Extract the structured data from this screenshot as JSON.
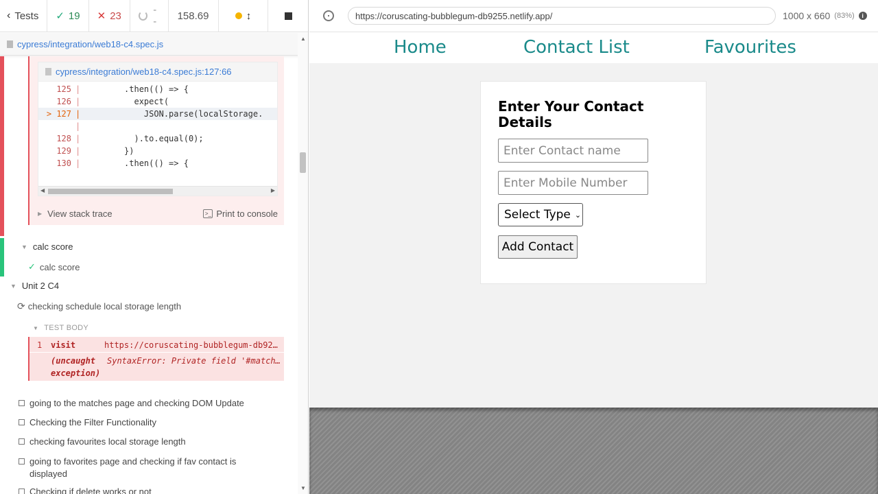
{
  "stats": {
    "tests_label": "Tests",
    "passed": "19",
    "failed": "23",
    "pending": "--",
    "duration": "158.69"
  },
  "spec": {
    "path": "cypress/integration/web18-c4.spec.js"
  },
  "error": {
    "code_frame_path": "cypress/integration/web18-c4.spec.js:127:66",
    "lines": [
      {
        "num": "125",
        "code": "        .then(() => {"
      },
      {
        "num": "126",
        "code": "          expect("
      },
      {
        "num": "127",
        "code": "            JSON.parse(localStorage."
      },
      {
        "num": "",
        "code": ""
      },
      {
        "num": "128",
        "code": "          ).to.equal(0);"
      },
      {
        "num": "129",
        "code": "        })"
      },
      {
        "num": "130",
        "code": "        .then(() => {"
      }
    ],
    "highlight_marker": ">",
    "view_stack_trace": "View stack trace",
    "print_to_console": "Print to console"
  },
  "tree": {
    "calc_suite": "calc score",
    "calc_test": "calc score",
    "unit_suite": "Unit 2 C4",
    "running_test": "checking schedule local storage length",
    "test_body_label": "TEST BODY",
    "command": {
      "num": "1",
      "name": "visit",
      "message": "https://coruscating-bubblegum-db92…",
      "exc_label_1": "(uncaught",
      "exc_label_2": "exception)",
      "exc_message": "SyntaxError: Private field '#match…"
    },
    "pending_tests": [
      "going to the matches page and checking DOM Update",
      "Checking the Filter Functionality",
      "checking favourites local storage length",
      "going to favorites page and checking if fav contact is",
      "displayed",
      "Checking if delete works or not"
    ]
  },
  "aut": {
    "url": "https://coruscating-bubblegum-db9255.netlify.app/",
    "viewport": "1000 x 660",
    "scale": "(83%)",
    "info_icon": "i"
  },
  "app": {
    "nav": [
      "Home",
      "Contact List",
      "Favourites"
    ],
    "form_title": "Enter Your Contact Details",
    "name_placeholder": "Enter Contact name",
    "mobile_placeholder": "Enter Mobile Number",
    "select_value": "Select Type",
    "add_button": "Add Contact"
  },
  "colors": {
    "pass": "#29c47b",
    "fail": "#e4515b",
    "link": "#3a7bd5",
    "nav_teal": "#1a8a8a"
  }
}
